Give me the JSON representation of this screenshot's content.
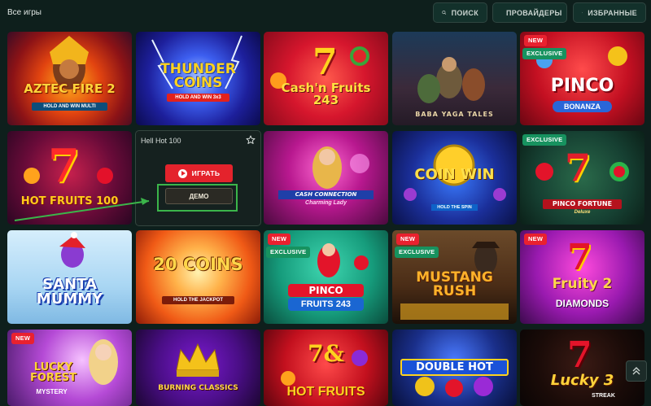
{
  "header": {
    "title": "Все игры",
    "search_label": "ПОИСК",
    "providers_label": "ПРОВАЙДЕРЫ",
    "favorites_label": "ИЗБРАННЫЕ"
  },
  "badges": {
    "new": "NEW",
    "exclusive": "EXCLUSIVE"
  },
  "hover": {
    "game_name": "Hell Hot 100",
    "play_label": "ИГРАТЬ",
    "demo_label": "ДЕМО"
  },
  "tiles": {
    "aztec": {
      "title": "AZTEC FIRE 2",
      "sub": "HOLD AND WIN MULTI"
    },
    "thunder": {
      "title": "THUNDER COINS",
      "sub": "HOLD AND WIN 3x3"
    },
    "cashin": {
      "title": "Cash'n Fruits 243"
    },
    "baba": {
      "title": "BABA YAGA TALES"
    },
    "pinco_bonanza": {
      "title": "PINCO",
      "sub": "BONANZA"
    },
    "hot_fruits": {
      "title": "HOT FRUITS 100"
    },
    "cash_conn": {
      "title": "CASH CONNECTION",
      "sub": "Charming Lady"
    },
    "coin_win": {
      "title": "COIN WIN",
      "sub": "HOLD THE SPIN"
    },
    "pinco_fortune": {
      "title": "PINCO FORTUNE",
      "sub": "Deluxe"
    },
    "santa": {
      "title": "SANTA MUMMY"
    },
    "coins20": {
      "title": "20 COINS",
      "sub": "HOLD THE JACKPOT"
    },
    "pinco_fruits": {
      "title": "PINCO",
      "sub": "FRUITS 243"
    },
    "mustang": {
      "title": "MUSTANG RUSH"
    },
    "fruity2": {
      "title": "Fruity 2",
      "sub": "DIAMONDS"
    },
    "lucky_forest": {
      "title": "LUCKY FOREST",
      "sub": "MYSTERY"
    },
    "burning": {
      "title": "BURNING CLASSICS"
    },
    "hot7": {
      "title": "7&",
      "sub": "HOT FRUITS"
    },
    "double_hot": {
      "title": "DOUBLE HOT"
    },
    "lucky3": {
      "title": "Lucky 3",
      "sub": "STREAK"
    }
  },
  "colors": {
    "background": "#0e1f1c",
    "play_button": "#e4232c",
    "new_badge": "#e9212f",
    "exclusive_badge": "#17925f",
    "highlight": "#3bb54a"
  }
}
